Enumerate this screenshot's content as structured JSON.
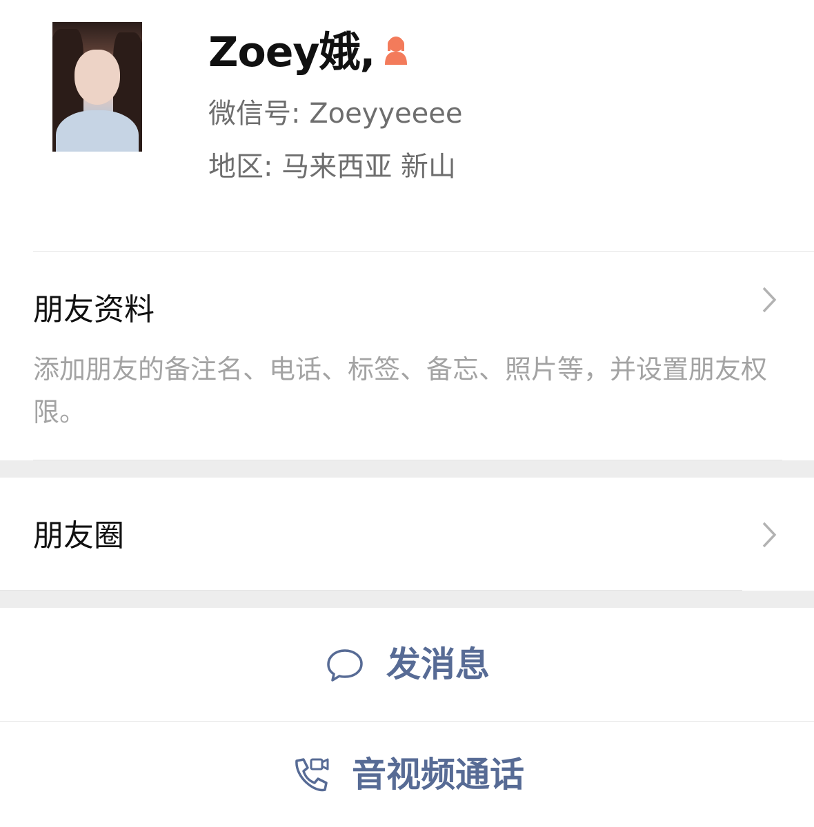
{
  "profile": {
    "name": "Zoey娥,",
    "wechat_id": "微信号: Zoeyyeeee",
    "region": "地区: 马来西亚  新山",
    "gender_icon": "female-icon",
    "gender_color": "#f37b5b"
  },
  "friend_info": {
    "title": "朋友资料",
    "description": "添加朋友的备注名、电话、标签、备忘、照片等，并设置朋友权限。"
  },
  "moments": {
    "title": "朋友圈"
  },
  "actions": {
    "message_label": "发消息",
    "call_label": "音视频通话",
    "accent_color": "#576b95"
  }
}
